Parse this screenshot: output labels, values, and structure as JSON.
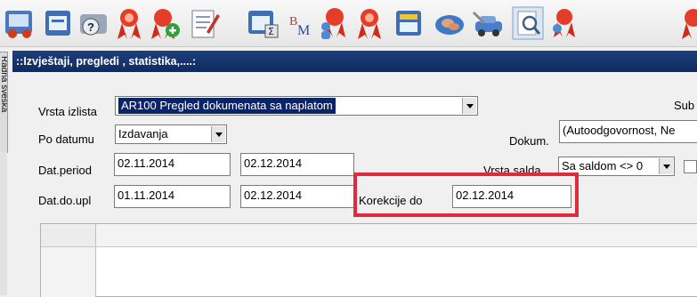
{
  "toolbar": {
    "icons": [
      "car-report-icon",
      "window-report-icon",
      "help-icon",
      "ribbon-award-icon",
      "ribbon-add-icon",
      "edit-document-icon",
      "sum-window-icon",
      "bm-icon",
      "ribbon-user-icon",
      "ribbon-icon",
      "card-window-icon",
      "handshake-icon",
      "car-wrench-icon",
      "magnify-document-icon",
      "ribbon-partial-icon",
      "ribbon-partial-icon-2"
    ],
    "bm_text": "BM"
  },
  "side_tab": {
    "label": "Radna sveska"
  },
  "window": {
    "title": "::Izvještaji, pregledi , statistika,....:"
  },
  "form": {
    "vrsta_izlista": {
      "label": "Vrsta izlista",
      "value": "AR100  Pregled dokumenata sa naplatom"
    },
    "sub_label": "Sub",
    "po_datumu": {
      "label": "Po datumu",
      "value": "Izdavanja"
    },
    "dokum": {
      "label": "Dokum.",
      "value": "(Autoodgovornost, Ne"
    },
    "dat_period": {
      "label": "Dat.period",
      "from": "02.11.2014",
      "to": "02.12.2014"
    },
    "vrsta_salda": {
      "label": "Vrsta salda",
      "value": "Sa saldom <> 0"
    },
    "dat_do_upl": {
      "label": "Dat.do.upl",
      "from": "01.11.2014",
      "to": "02.12.2014"
    },
    "korekcije_do": {
      "label": "Korekcije do",
      "value": "02.12.2014"
    }
  },
  "colors": {
    "title_bar": "#1d3f7c",
    "highlight_box": "#e02b3c",
    "selection": "#0a246a"
  }
}
